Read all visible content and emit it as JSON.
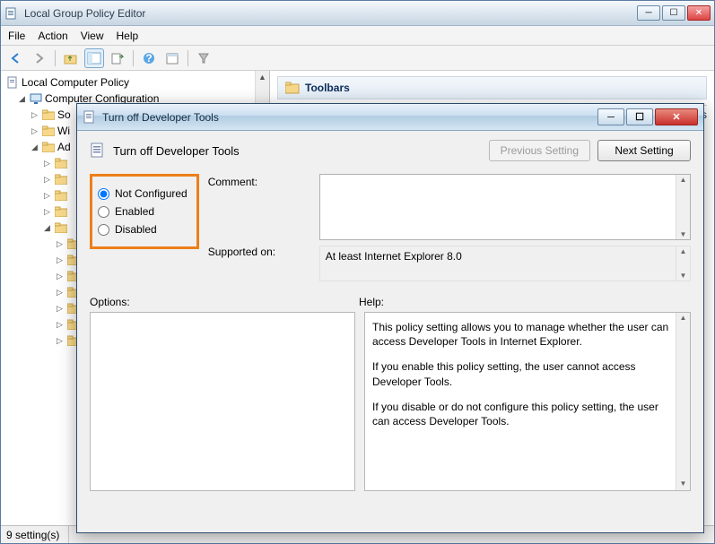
{
  "main_window": {
    "title": "Local Group Policy Editor",
    "menu": {
      "file": "File",
      "action": "Action",
      "view": "View",
      "help": "Help"
    },
    "tree": {
      "root": "Local Computer Policy",
      "computer_config": "Computer Configuration",
      "so": "So",
      "wi": "Wi",
      "ad": "Ad",
      "placeholder": ""
    },
    "right": {
      "toolbar_header": "Toolbars",
      "detail_header_left": "",
      "detail_header_right": "Turn off Developer Tools"
    },
    "status": "9 setting(s)"
  },
  "dialog": {
    "title": "Turn off Developer Tools",
    "header_title": "Turn off Developer Tools",
    "buttons": {
      "prev": "Previous Setting",
      "next": "Next Setting"
    },
    "radios": {
      "not_configured": "Not Configured",
      "enabled": "Enabled",
      "disabled": "Disabled",
      "selected": "not_configured"
    },
    "comment_label": "Comment:",
    "comment_value": "",
    "supported_label": "Supported on:",
    "supported_value": "At least Internet Explorer 8.0",
    "options_label": "Options:",
    "help_label": "Help:",
    "help_text": {
      "p1": "This policy setting allows you to manage whether the user can access Developer Tools in Internet Explorer.",
      "p2": "If you enable this policy setting, the user cannot access Developer Tools.",
      "p3": "If you disable or do not configure this policy setting, the user can access Developer Tools."
    }
  }
}
